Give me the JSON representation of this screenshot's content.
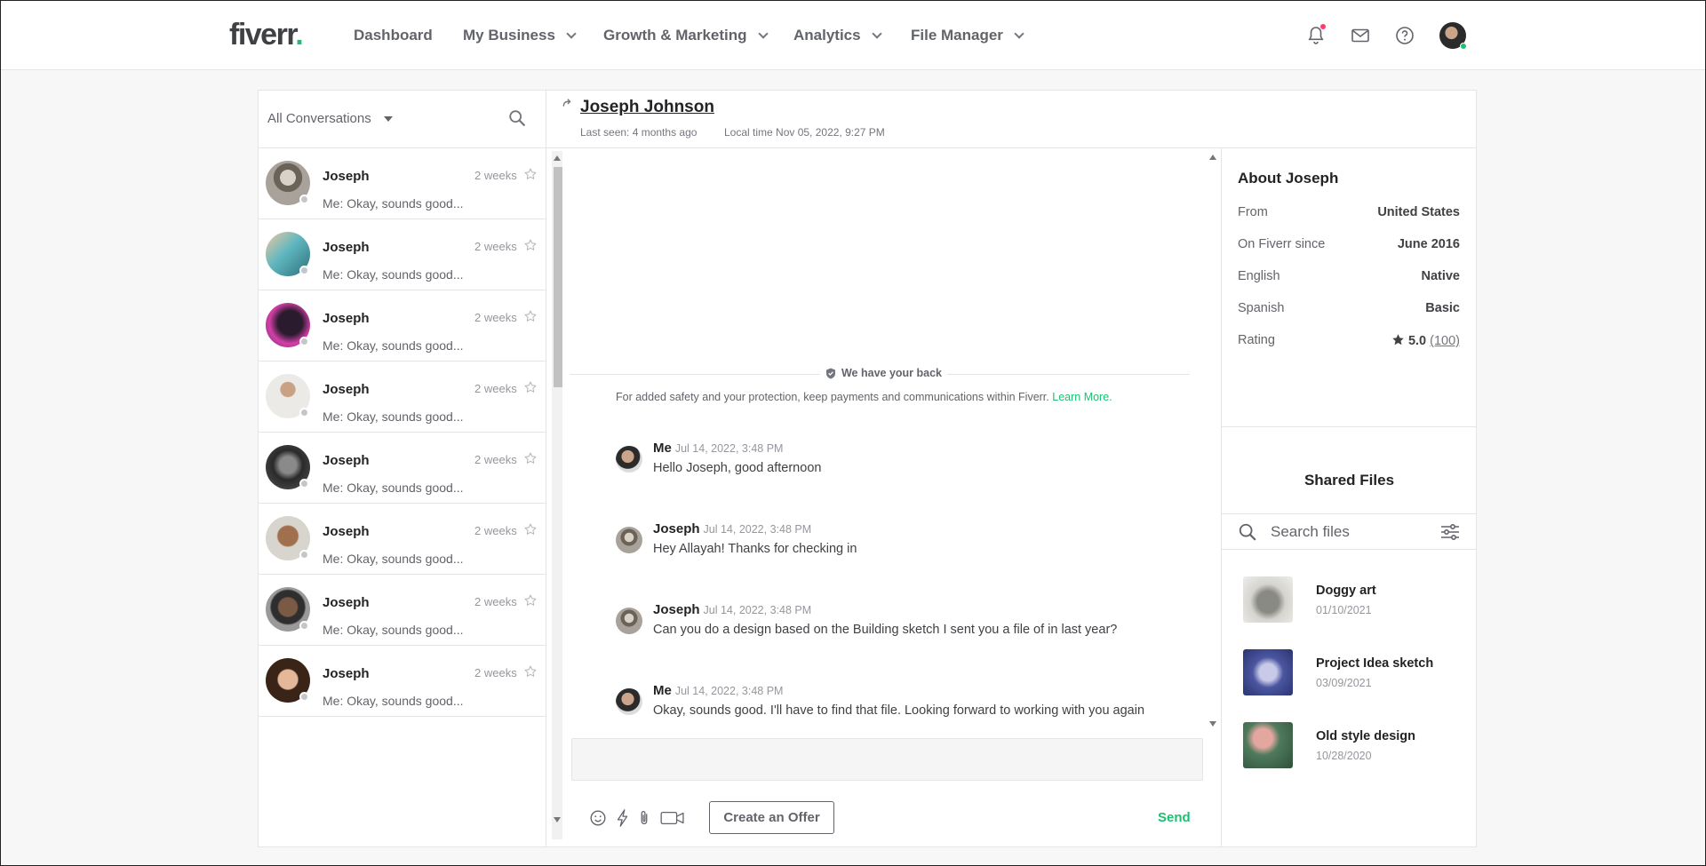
{
  "brand": {
    "logo_text": "fiverr",
    "logo_dot": ".",
    "accent": "#1dbf73"
  },
  "nav": {
    "items": [
      {
        "label": "Dashboard",
        "dropdown": false
      },
      {
        "label": "My Business",
        "dropdown": true
      },
      {
        "label": "Growth & Marketing",
        "dropdown": true
      },
      {
        "label": "Analytics",
        "dropdown": true
      },
      {
        "label": "File Manager",
        "dropdown": true
      }
    ],
    "icons": [
      "bell-icon",
      "mail-icon",
      "help-icon"
    ]
  },
  "conversations": {
    "filter_label": "All Conversations",
    "items": [
      {
        "name": "Joseph",
        "time": "2 weeks",
        "preview": "Me: Okay, sounds good..."
      },
      {
        "name": "Joseph",
        "time": "2 weeks",
        "preview": "Me: Okay, sounds good..."
      },
      {
        "name": "Joseph",
        "time": "2 weeks",
        "preview": "Me: Okay, sounds good..."
      },
      {
        "name": "Joseph",
        "time": "2 weeks",
        "preview": "Me: Okay, sounds good..."
      },
      {
        "name": "Joseph",
        "time": "2 weeks",
        "preview": "Me: Okay, sounds good..."
      },
      {
        "name": "Joseph",
        "time": "2 weeks",
        "preview": "Me: Okay, sounds good..."
      },
      {
        "name": "Joseph",
        "time": "2 weeks",
        "preview": "Me: Okay, sounds good..."
      },
      {
        "name": "Joseph",
        "time": "2 weeks",
        "preview": "Me: Okay, sounds good..."
      }
    ]
  },
  "chat": {
    "contact_name": "Joseph Johnson",
    "last_seen": "Last seen: 4 months ago",
    "local_time": "Local time Nov 05, 2022, 9:27 PM",
    "safety_title": "We have your back",
    "safety_text": "For added safety and your protection, keep payments and communications within Fiverr.",
    "safety_link": "Learn More.",
    "messages": [
      {
        "from": "Me",
        "time": "Jul 14, 2022, 3:48 PM",
        "text": "Hello Joseph, good afternoon"
      },
      {
        "from": "Joseph",
        "time": "Jul 14, 2022, 3:48 PM",
        "text": "Hey Allayah! Thanks for checking in"
      },
      {
        "from": "Joseph",
        "time": "Jul 14, 2022, 3:48 PM",
        "text": "Can you do a design based on the Building sketch I sent you a file of in last year?"
      },
      {
        "from": "Me",
        "time": "Jul 14, 2022, 3:48 PM",
        "text": "Okay, sounds good. I'll have to find that file. Looking forward to working with you again"
      }
    ],
    "compose_placeholder": "",
    "offer_button": "Create an Offer",
    "send_button": "Send"
  },
  "about": {
    "title": "About Joseph",
    "rows": [
      {
        "key": "From",
        "value": "United States"
      },
      {
        "key": "On Fiverr since",
        "value": "June 2016"
      },
      {
        "key": "English",
        "value": "Native"
      },
      {
        "key": "Spanish",
        "value": "Basic"
      }
    ],
    "rating_label": "Rating",
    "rating_value": "5.0",
    "rating_count": "(100)"
  },
  "shared_files": {
    "title": "Shared Files",
    "search_placeholder": "Search files",
    "files": [
      {
        "name": "Doggy art",
        "date": "01/10/2021"
      },
      {
        "name": "Project Idea sketch",
        "date": "03/09/2021"
      },
      {
        "name": "Old style design",
        "date": "10/28/2020"
      }
    ]
  }
}
